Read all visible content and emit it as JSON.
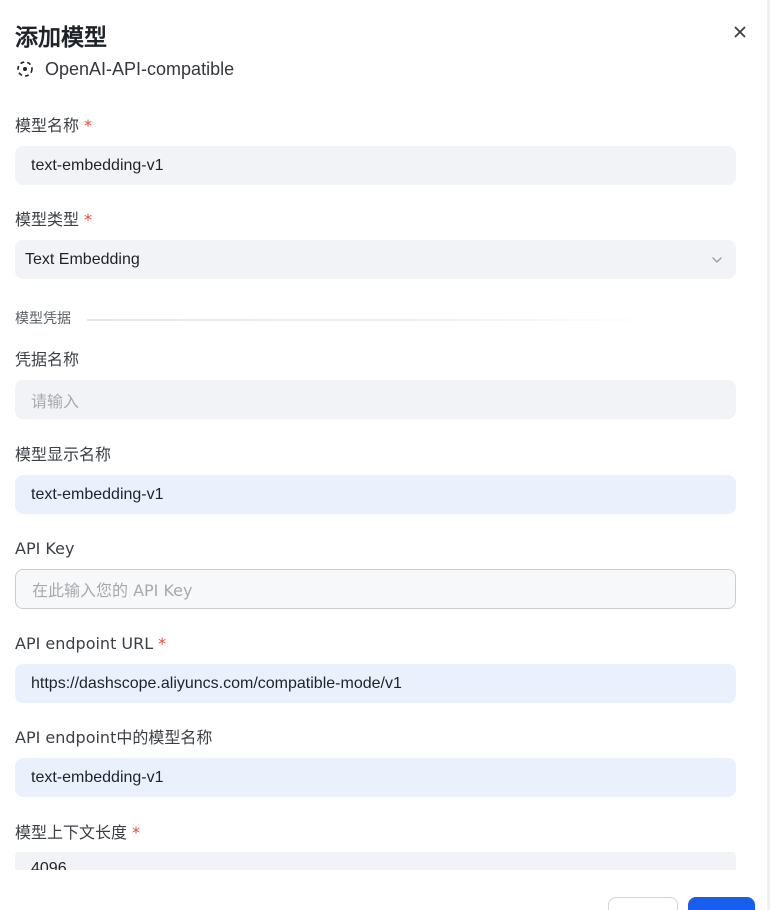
{
  "dialog": {
    "title": "添加模型",
    "provider_name": "OpenAI-API-compatible",
    "close_icon": "close-icon"
  },
  "fields": {
    "model_name": {
      "label": "模型名称",
      "required_mark": "*",
      "value": "text-embedding-v1"
    },
    "model_type": {
      "label": "模型类型",
      "required_mark": "*",
      "value": "Text Embedding"
    },
    "section": {
      "title": "模型凭据"
    },
    "credential_name": {
      "label": "凭据名称",
      "placeholder": "请输入"
    },
    "display_name": {
      "label": "模型显示名称",
      "value": "text-embedding-v1"
    },
    "api_key": {
      "label": "API Key",
      "placeholder": "在此输入您的 API Key"
    },
    "endpoint_url": {
      "label": "API endpoint URL",
      "required_mark": "*",
      "value": "https://dashscope.aliyuncs.com/compatible-mode/v1"
    },
    "endpoint_model_name": {
      "label": "API endpoint中的模型名称",
      "value": "text-embedding-v1"
    },
    "context_length": {
      "label": "模型上下文长度",
      "required_mark": "*",
      "value": "4096"
    }
  },
  "colors": {
    "primary": "#155eef",
    "required": "#f04438",
    "filled_bg": "#eaf1fd",
    "input_bg": "#f2f3f6"
  }
}
